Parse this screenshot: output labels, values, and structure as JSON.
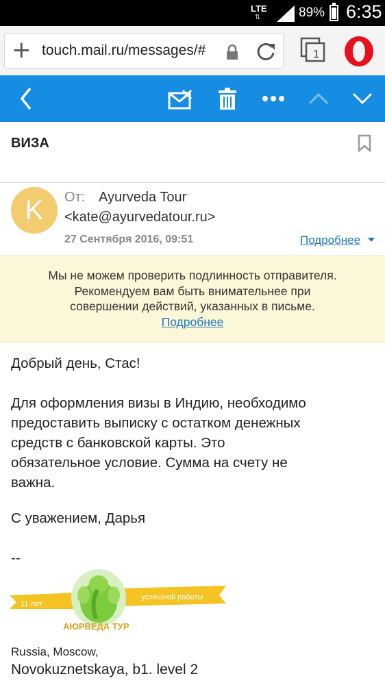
{
  "status_bar": {
    "network": "LTE",
    "battery": "89%",
    "battery_level": 0.89,
    "time": "6:35"
  },
  "browser": {
    "url": "touch.mail.ru/messages/#",
    "tab_count": "1",
    "icons": [
      "plus-icon",
      "lock-icon",
      "reload-icon",
      "tabs-icon",
      "opera-icon"
    ]
  },
  "toolbar": {
    "accent": "#168de2",
    "icons": [
      "back-icon",
      "spam-icon",
      "trash-icon",
      "more-icon",
      "up-icon",
      "down-icon"
    ]
  },
  "message": {
    "subject": "ВИЗА",
    "avatar_letter": "K",
    "avatar_color": "#f2cc6e",
    "from_label": "От:",
    "from_name": "Ayurveda Tour",
    "from_email": "<kate@ayurvedatour.ru>",
    "date": "27 Сентября 2016, 09:51",
    "details_link": "Подробнее"
  },
  "warning": {
    "line1": "Мы не можем проверить подлинность отправителя.",
    "line2": "Рекомендуем вам быть внимательнее при",
    "line3": "совершении действий, указанных в письме.",
    "link": "Подробнее",
    "background": "#fcf7d8"
  },
  "body": {
    "greeting": "Добрый день, Стас!",
    "para_line1": "Для оформления визы в Индию, необходимо",
    "para_line2": "предоставить выписку с остатком денежных",
    "para_line3": "средств с банковской карты. Это",
    "para_line4": "обязательное условие. Сумма на счету не",
    "para_line5": "важна.",
    "closing": "С уважением, Дарья",
    "separator": "--"
  },
  "signature": {
    "logo_years": "11 лет",
    "logo_text": "успешной работы",
    "logo_brand": "АЮРВЕДА ТУР",
    "address_line1": "Russia, Moscow,",
    "address_line2": "Novokuznetskaya, b1. level 2"
  }
}
